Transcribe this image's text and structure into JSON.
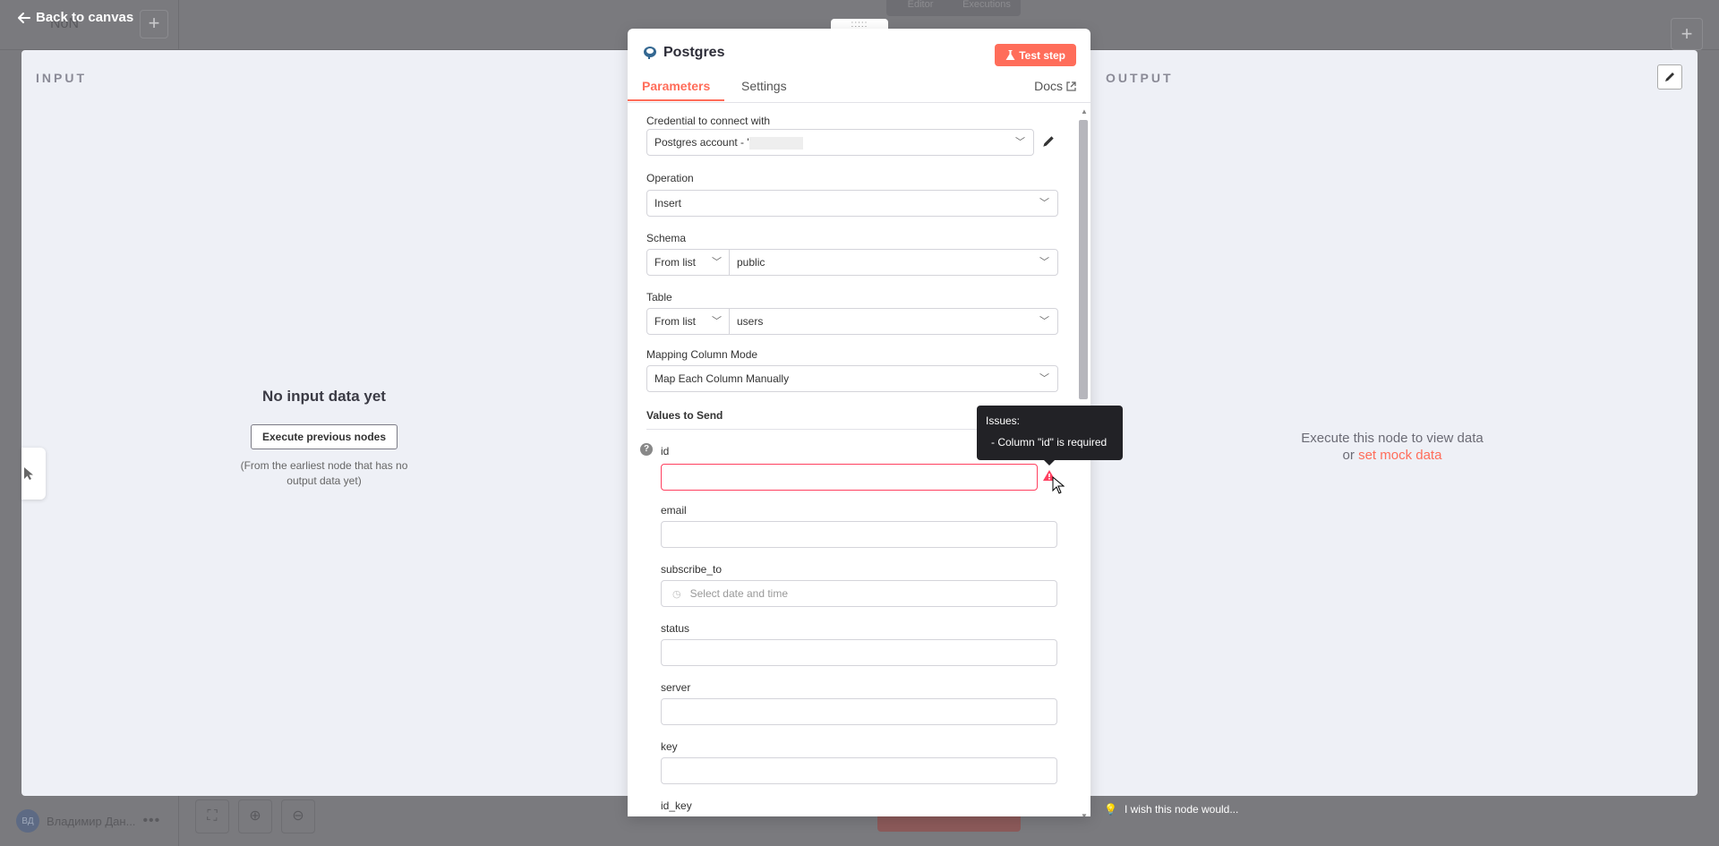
{
  "background": {
    "workflow_title": "NoN",
    "toggle_tabs": [
      "Editor",
      "Executions"
    ],
    "user_initials": "ВД",
    "user_name": "Владимир Дан...",
    "more_dots": "•••"
  },
  "ndv": {
    "back_label": "Back to canvas",
    "input_label": "INPUT",
    "output_label": "OUTPUT",
    "input_empty_title": "No input data yet",
    "execute_previous_label": "Execute previous nodes",
    "input_empty_hint": "(From the earliest node that has no output data yet)",
    "output_empty_line1": "Execute this node to view data",
    "output_empty_or": "or",
    "output_mock_link": "set mock data",
    "wish_text": "I wish this node would..."
  },
  "node": {
    "drag_handle": ":::::",
    "title": "Postgres",
    "test_step_label": "Test step",
    "tabs": {
      "parameters": "Parameters",
      "settings": "Settings"
    },
    "docs_label": "Docs",
    "credential": {
      "label": "Credential to connect with",
      "value": "Postgres account - '"
    },
    "operation": {
      "label": "Operation",
      "value": "Insert"
    },
    "schema": {
      "label": "Schema",
      "mode": "From list",
      "value": "public"
    },
    "table": {
      "label": "Table",
      "mode": "From list",
      "value": "users"
    },
    "mapping": {
      "label": "Mapping Column Mode",
      "value": "Map Each Column Manually"
    },
    "values_to_send_title": "Values to Send",
    "columns": [
      {
        "label": "id",
        "value": "",
        "placeholder": ""
      },
      {
        "label": "email",
        "value": "",
        "placeholder": ""
      },
      {
        "label": "subscribe_to",
        "value": "",
        "placeholder": "Select date and time"
      },
      {
        "label": "status",
        "value": "",
        "placeholder": ""
      },
      {
        "label": "server",
        "value": "",
        "placeholder": ""
      },
      {
        "label": "key",
        "value": "",
        "placeholder": ""
      },
      {
        "label": "id_key",
        "value": "",
        "placeholder": ""
      }
    ]
  },
  "tooltip": {
    "title": "Issues:",
    "message": "- Column \"id\" is required"
  },
  "colors": {
    "accent": "#ff6d5a",
    "error": "#ff4060",
    "tooltip_bg": "#222226"
  }
}
